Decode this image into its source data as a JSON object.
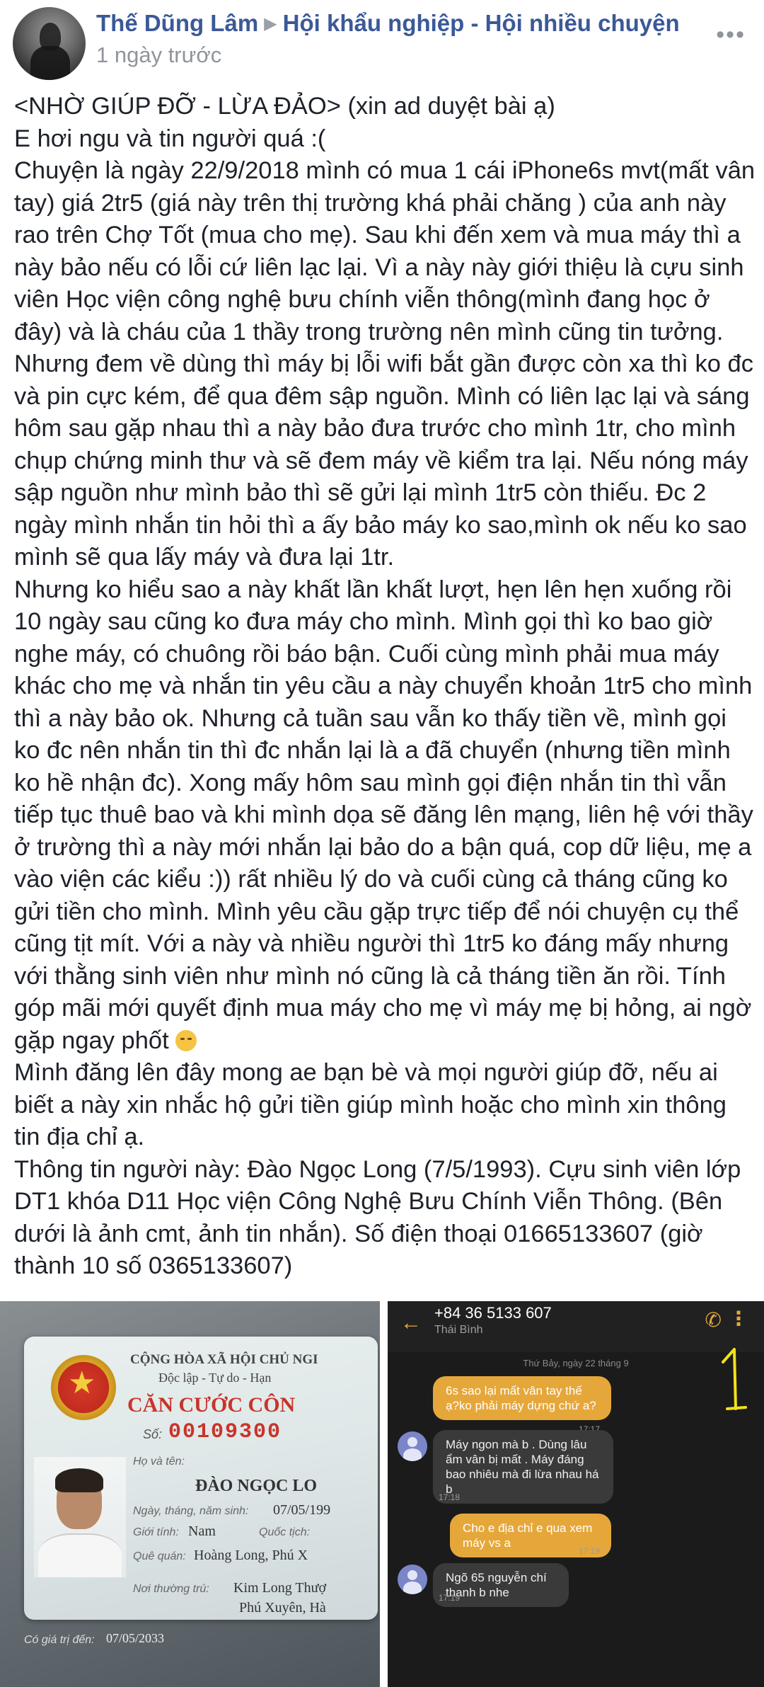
{
  "post": {
    "author": "Thế Dũng Lâm",
    "group": "Hội khẩu nghiệp - Hội nhiều chuyện",
    "time": "1 ngày trước",
    "paragraphs": [
      "<NHỜ GIÚP ĐỠ - LỪA ĐẢO> (xin ad duyệt bài ạ)",
      "E hơi ngu và tin người quá :(",
      "Chuyện là ngày 22/9/2018 mình có mua 1 cái iPhone6s mvt(mất vân tay) giá 2tr5 (giá này trên thị trường khá phải chăng ) của anh này rao trên Chợ Tốt (mua cho mẹ). Sau khi đến xem và mua máy thì a này bảo nếu có lỗi cứ liên lạc lại. Vì a này này giới thiệu là cựu sinh viên Học viện công nghệ bưu chính viễn thông(mình đang học ở đây) và là cháu của 1 thầy trong trường nên mình cũng tin tưởng. Nhưng đem về dùng thì máy bị lỗi wifi bắt gần được còn xa thì ko đc và pin cực kém, để qua đêm sập nguồn. Mình có liên lạc lại và sáng hôm sau gặp nhau thì a này bảo đưa trước cho mình 1tr, cho mình chụp chứng minh thư và sẽ đem máy về kiểm tra lại. Nếu nóng máy sập nguồn như mình bảo thì sẽ gửi lại mình 1tr5 còn thiếu. Đc 2 ngày mình nhắn tin hỏi thì a ấy bảo máy ko sao,mình ok nếu ko sao mình sẽ qua lấy máy và đưa lại 1tr.",
      "Nhưng ko hiểu sao a này khất lần khất lượt, hẹn lên hẹn xuống rồi 10 ngày sau cũng ko đưa máy cho mình. Mình gọi thì ko bao giờ nghe máy, có chuông rồi báo bận. Cuối cùng mình phải mua máy khác cho mẹ và nhắn tin yêu cầu a này chuyển khoản 1tr5 cho mình thì a này bảo ok. Nhưng cả tuần sau vẫn ko thấy tiền về, mình gọi ko đc nên nhắn tin thì đc nhắn lại là a đã chuyển (nhưng tiền mình ko hề nhận đc). Xong mấy hôm sau mình gọi điện nhắn tin thì vẫn tiếp tục thuê bao và khi mình dọa sẽ đăng lên mạng, liên hệ với thầy ở trường thì a này mới nhắn lại bảo do a bận quá, cop dữ liệu, mẹ a vào viện các kiểu :)) rất nhiều lý do và cuối cùng cả tháng cũng ko gửi tiền cho mình. Mình yêu cầu gặp trực tiếp để nói chuyện cụ thể cũng tịt mít. Với a này và nhiều người thì 1tr5 ko đáng mấy nhưng với thằng sinh viên như mình nó cũng là cả tháng tiền ăn rồi. Tính góp mãi mới quyết định mua máy cho mẹ vì máy mẹ bị hỏng, ai ngờ gặp ngay phốt",
      "Mình đăng lên đây mong ae bạn bè và mọi người giúp đỡ, nếu ai biết a này xin nhắc hộ gửi tiền giúp mình hoặc cho mình xin thông tin địa chỉ ạ.",
      "Thông tin người này: Đào Ngọc Long (7/5/1993). Cựu sinh viên lớp DT1 khóa D11 Học viện Công Nghệ Bưu Chính Viễn Thông. (Bên dưới là ảnh cmt, ảnh tin nhắn). Số điện thoại 01665133607 (giờ thành 10 số 0365133607)"
    ]
  },
  "icons": {
    "more": "more-icon",
    "arrow": "right-triangle-icon",
    "emoji": "disappointed-face-icon"
  },
  "id_card": {
    "republic": "CỘNG HÒA XÃ HỘI CHỦ NGI",
    "motto": "Độc lập - Tự do - Hạn",
    "title": "CĂN CƯỚC CÔN",
    "no_label": "Số:",
    "number": "00109300",
    "name_label": "Họ và tên:",
    "name": "ĐÀO NGỌC LO",
    "dob_label": "Ngày, tháng, năm sinh:",
    "dob": "07/05/199",
    "sex_label": "Giới tính:",
    "sex": "Nam",
    "nationality_label": "Quốc tịch:",
    "hometown_label": "Quê quán:",
    "hometown": "Hoàng Long, Phú X",
    "residence_label": "Nơi thường trú:",
    "residence1": "Kim Long Thượ",
    "residence2": "Phú Xuyên, Hà",
    "expiry_label": "Có giá trị đến:",
    "expiry": "07/05/2033"
  },
  "chat": {
    "number": "+84 36 5133 607",
    "location": "Thái Bình",
    "date": "Thứ Bảy, ngày 22 tháng 9",
    "messages": [
      {
        "dir": "out",
        "text": "6s sao lại mất vân tay thế ạ?ko phải máy dựng chứ a?",
        "time": "17:17"
      },
      {
        "dir": "in",
        "text": "Máy ngon mà b . Dùng lâu ẩm vân bị mất . Máy đáng bao nhiêu mà đi lừa nhau há b",
        "time": "17:18"
      },
      {
        "dir": "out",
        "text": "Cho e địa chỉ e qua xem máy vs a",
        "time": "17:19"
      },
      {
        "dir": "in",
        "text": "Ngõ 65 nguyễn chí thanh b nhe",
        "time": "17:19"
      }
    ],
    "accent": "#e6a73a"
  }
}
